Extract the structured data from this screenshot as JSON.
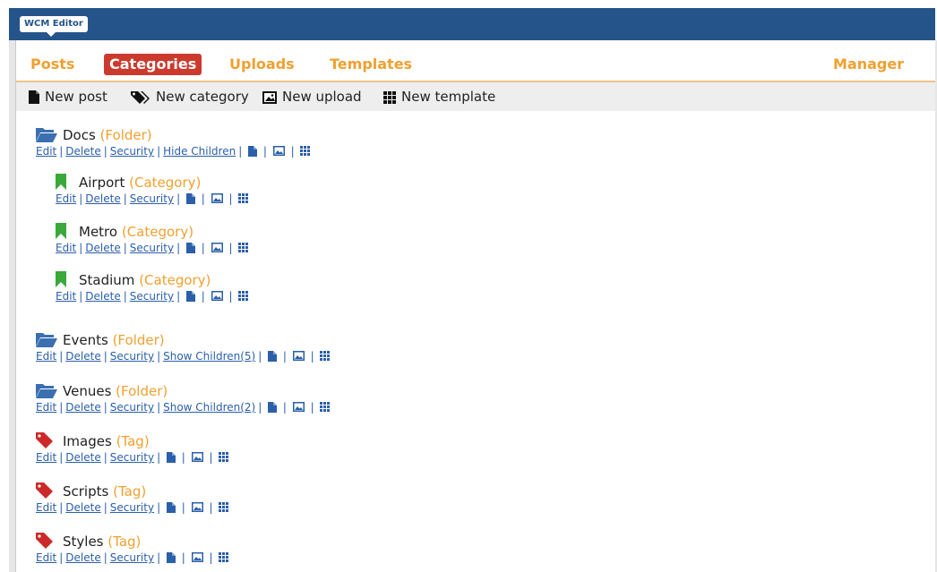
{
  "app": {
    "title": "WCM Editor"
  },
  "nav": {
    "posts": "Posts",
    "categories": "Categories",
    "uploads": "Uploads",
    "templates": "Templates",
    "manager": "Manager"
  },
  "toolbar": {
    "new_post": "New post",
    "new_category": "New category",
    "new_upload": "New upload",
    "new_template": "New template"
  },
  "actions": {
    "edit": "Edit",
    "delete": "Delete",
    "security": "Security",
    "hide_children": "Hide Children",
    "show_children_5": "Show Children(5)",
    "show_children_2": "Show Children(2)"
  },
  "entries": {
    "docs": {
      "name": "Docs",
      "type": "(Folder)"
    },
    "airport": {
      "name": "Airport",
      "type": "(Category)"
    },
    "metro": {
      "name": "Metro",
      "type": "(Category)"
    },
    "stadium": {
      "name": "Stadium",
      "type": "(Category)"
    },
    "events": {
      "name": "Events",
      "type": "(Folder)"
    },
    "venues": {
      "name": "Venues",
      "type": "(Folder)"
    },
    "images": {
      "name": "Images",
      "type": "(Tag)"
    },
    "scripts": {
      "name": "Scripts",
      "type": "(Tag)"
    },
    "styles": {
      "name": "Styles",
      "type": "(Tag)"
    }
  },
  "colors": {
    "topbar": "#24548a",
    "nav_accent": "#f0a030",
    "active_tab": "#cc3a2e",
    "folder_icon": "#3a6fb0",
    "category_icon": "#3aa83a",
    "tag_icon": "#cc2a2a",
    "link": "#2b5fa8"
  },
  "icons": {
    "folder": "folder-open-icon",
    "category": "bookmark-icon",
    "tag": "tag-icon",
    "post": "file-icon",
    "upload": "image-icon",
    "template": "grid-icon"
  }
}
